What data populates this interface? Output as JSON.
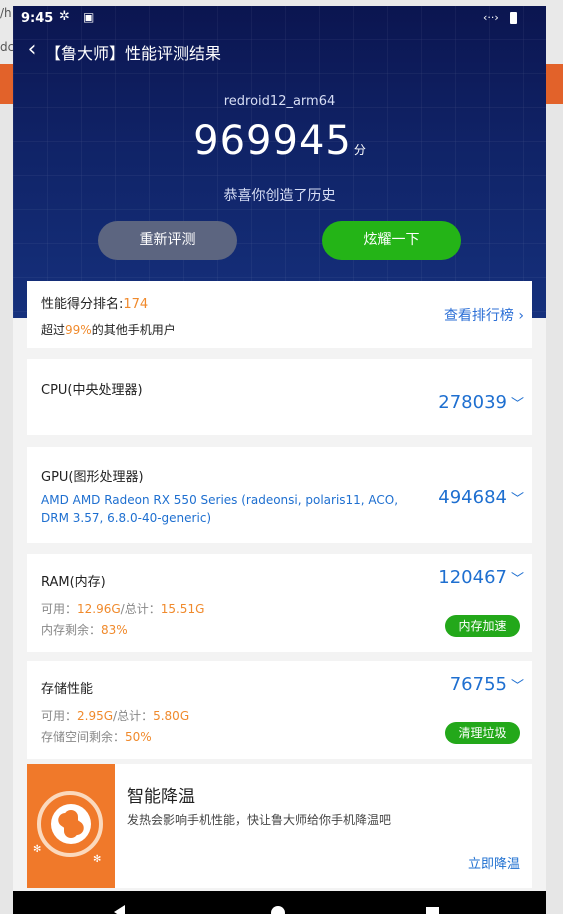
{
  "background": {
    "url_fragment": "/h",
    "url_fragment2": "dc"
  },
  "status": {
    "time": "9:45"
  },
  "topbar": {
    "back": "‹",
    "title": "【鲁大师】性能评测结果"
  },
  "hero": {
    "device": "redroid12_arm64",
    "score": "969945",
    "score_unit": "分",
    "congrats": "恭喜你创造了历史",
    "retest_label": "重新评测",
    "share_label": "炫耀一下"
  },
  "rank": {
    "label": "性能得分排名:",
    "value": "174",
    "sub_prefix": "超过",
    "sub_pct": "99%",
    "sub_suffix": "的其他手机用户",
    "link": "查看排行榜 ›"
  },
  "cpu": {
    "title": "CPU(中央处理器)",
    "score": "278039"
  },
  "gpu": {
    "title": "GPU(图形处理器)",
    "score": "494684",
    "desc": "AMD AMD Radeon RX 550 Series (radeonsi, polaris11, ACO, DRM 3.57, 6.8.0-40-generic)"
  },
  "ram": {
    "title": "RAM(内存)",
    "score": "120467",
    "avail_label": "可用：",
    "avail": "12.96G",
    "total_label": "/总计：",
    "total": "15.51G",
    "remain_label": "内存剩余：",
    "remain": "83%",
    "action": "内存加速"
  },
  "storage": {
    "title": "存储性能",
    "score": "76755",
    "avail_label": "可用：",
    "avail": "2.95G",
    "total_label": "/总计：",
    "total": "5.80G",
    "remain_label": "存储空间剩余：",
    "remain": "50%",
    "action": "清理垃圾"
  },
  "cool": {
    "title": "智能降温",
    "desc": "发热会影响手机性能，快让鲁大师给你手机降温吧",
    "link": "立即降温"
  },
  "colors": {
    "accent_blue": "#1e6fd0",
    "accent_green": "#23a81a",
    "accent_orange": "#f08a2c"
  },
  "icons": {
    "chevron": "chevron-down-icon",
    "status": [
      "settings-icon",
      "sim-icon",
      "code-icon",
      "battery-icon"
    ],
    "nav": [
      "back-icon",
      "home-icon",
      "recent-icon"
    ]
  }
}
